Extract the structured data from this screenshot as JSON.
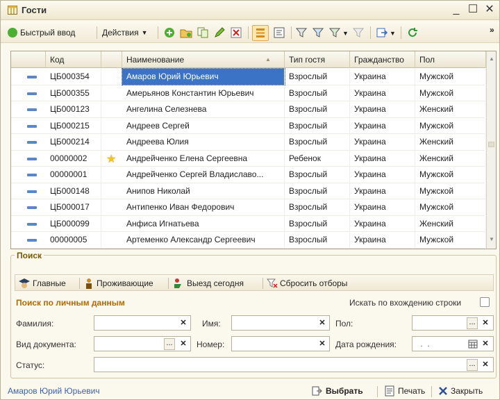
{
  "window": {
    "title": "Гости",
    "minimize_glyph": "_",
    "maximize_glyph": "☐",
    "close_glyph": "✕"
  },
  "toolbar": {
    "quick_input_label": "Быстрый ввод",
    "actions_label": "Действия",
    "overflow_glyph": "»"
  },
  "grid": {
    "columns": [
      "Код",
      "Наименование",
      "Тип гостя",
      "Гражданство",
      "Пол"
    ],
    "sort_glyph": "▲",
    "rows": [
      {
        "code": "ЦБ000354",
        "name": "Амаров Юрий Юрьевич",
        "guest_type": "Взрослый",
        "citizenship": "Украина",
        "gender": "Мужской",
        "star": false
      },
      {
        "code": "ЦБ000355",
        "name": "Амерьянов Константин Юрьевич",
        "guest_type": "Взрослый",
        "citizenship": "Украина",
        "gender": "Мужской",
        "star": false
      },
      {
        "code": "ЦБ000123",
        "name": "Ангелина Селезнева",
        "guest_type": "Взрослый",
        "citizenship": "Украина",
        "gender": "Женский",
        "star": false
      },
      {
        "code": "ЦБ000215",
        "name": "Андреев Сергей",
        "guest_type": "Взрослый",
        "citizenship": "Украина",
        "gender": "Мужской",
        "star": false
      },
      {
        "code": "ЦБ000214",
        "name": "Андреева Юлия",
        "guest_type": "Взрослый",
        "citizenship": "Украина",
        "gender": "Женский",
        "star": false
      },
      {
        "code": "00000002",
        "name": "Андрейченко Елена Сергеевна",
        "guest_type": "Ребенок",
        "citizenship": "Украина",
        "gender": "Женский",
        "star": true
      },
      {
        "code": "00000001",
        "name": "Андрейченко Сергей Владиславо...",
        "guest_type": "Взрослый",
        "citizenship": "Украина",
        "gender": "Мужской",
        "star": false
      },
      {
        "code": "ЦБ000148",
        "name": "Анипов Николай",
        "guest_type": "Взрослый",
        "citizenship": "Украина",
        "gender": "Мужской",
        "star": false
      },
      {
        "code": "ЦБ000017",
        "name": "Антипенко Иван Федорович",
        "guest_type": "Взрослый",
        "citizenship": "Украина",
        "gender": "Мужской",
        "star": false
      },
      {
        "code": "ЦБ000099",
        "name": "Анфиса Игнатьева",
        "guest_type": "Взрослый",
        "citizenship": "Украина",
        "gender": "Женский",
        "star": false
      },
      {
        "code": "00000005",
        "name": "Артеменко Александр Сергеевич",
        "guest_type": "Взрослый",
        "citizenship": "Украина",
        "gender": "Мужской",
        "star": false
      }
    ],
    "selected_row": 0
  },
  "search": {
    "title": "Поиск",
    "filters": {
      "main_label": "Главные",
      "residing_label": "Проживающие",
      "checkout_today_label": "Выезд сегодня",
      "reset_label": "Сбросить отборы"
    },
    "personal_title": "Поиск по личным данным",
    "substring_label": "Искать по вхождению строки",
    "fields": {
      "last_name_label": "Фамилия:",
      "first_name_label": "Имя:",
      "gender_label": "Пол:",
      "doc_type_label": "Вид документа:",
      "number_label": "Номер:",
      "birth_date_label": "Дата рождения:",
      "birth_date_value": " .  .",
      "status_label": "Статус:"
    },
    "clear_glyph": "✕",
    "dots_glyph": "..."
  },
  "footer": {
    "current_guest": "Амаров Юрий Юрьевич",
    "select_label": "Выбрать",
    "print_label": "Печать",
    "close_label": "Закрыть"
  },
  "colors": {
    "selection": "#3b74c7",
    "accent_title": "#b06a00",
    "footer_link": "#3b63a8"
  }
}
